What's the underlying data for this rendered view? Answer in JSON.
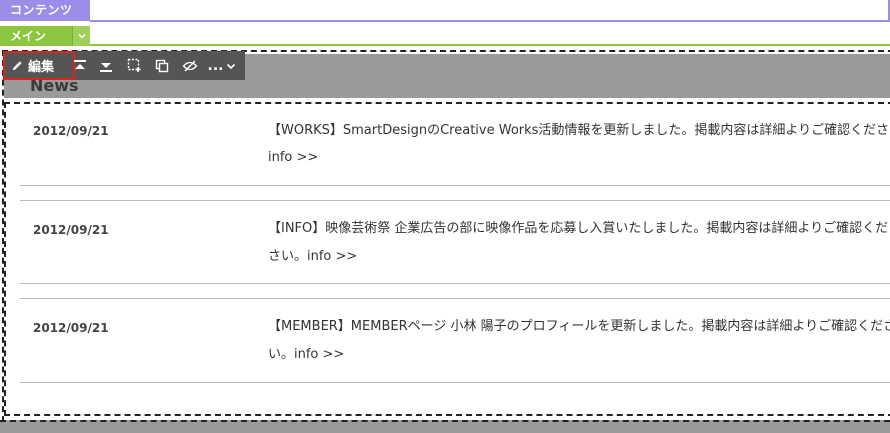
{
  "labels": {
    "contents": "コンテンツ",
    "main": "メイン"
  },
  "toolbar": {
    "edit_label": "編集",
    "more_label": "..."
  },
  "section": {
    "title": "News"
  },
  "news": [
    {
      "date": "2012/09/21",
      "line1": "【WORKS】SmartDesignのCreative Works活動情報を更新しました。掲載内容は詳細よりご確認ください。",
      "line2": "info >>"
    },
    {
      "date": "2012/09/21",
      "line1": "【INFO】映像芸術祭 企業広告の部に映像作品を応募し入賞いたしました。掲載内容は詳細よりご確認くだ",
      "line2": "さい。info >>"
    },
    {
      "date": "2012/09/21",
      "line1": "【MEMBER】MEMBERページ 小林 陽子のプロフィールを更新しました。掲載内容は詳細よりご確認くださ",
      "line2": "い。info >>"
    }
  ],
  "colors": {
    "contents_accent": "#9b8ee8",
    "main_accent": "#8cc63f",
    "toolbar_bg": "#555555",
    "edit_highlight": "#e02020"
  }
}
